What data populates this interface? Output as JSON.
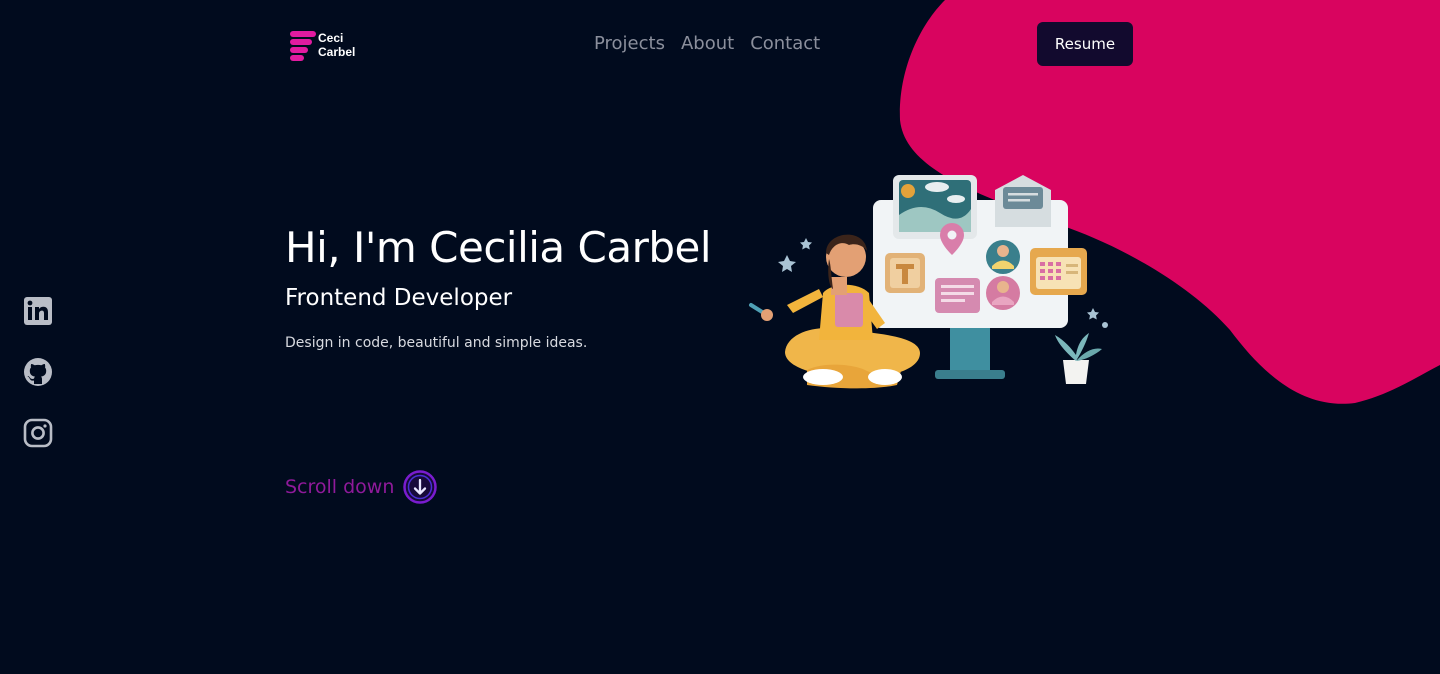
{
  "brand": {
    "line1": "Ceci",
    "line2": "Carbel",
    "accent": "#e21ba0"
  },
  "nav": {
    "items": [
      {
        "label": "Projects"
      },
      {
        "label": "About"
      },
      {
        "label": "Contact"
      }
    ],
    "resume_label": "Resume"
  },
  "socials": [
    {
      "icon": "linkedin-icon"
    },
    {
      "icon": "github-icon"
    },
    {
      "icon": "instagram-icon"
    }
  ],
  "hero": {
    "title": "Hi, I'm Cecilia Carbel",
    "subtitle": "Frontend Developer",
    "tagline": "Design in code, beautiful and simple ideas."
  },
  "scroll": {
    "label": "Scroll down",
    "icon": "arrow-down-circle-icon"
  },
  "colors": {
    "background": "#010b1e",
    "blob": "#d9045f",
    "scroll_accent": "#8f1a9a"
  }
}
